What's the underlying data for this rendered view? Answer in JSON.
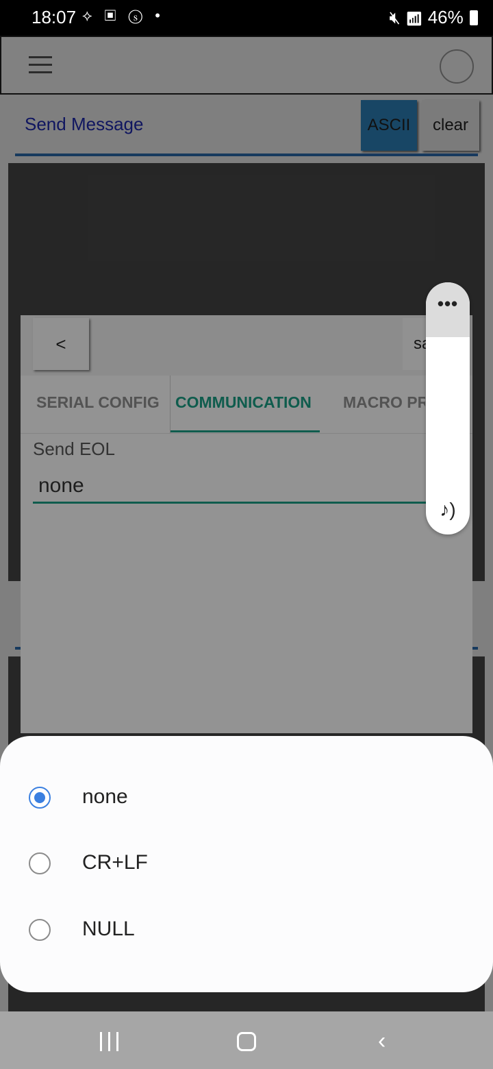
{
  "status_bar": {
    "time": "18:07",
    "left_icons": "⟡ ▣ ⓢ •",
    "right_text": "46%",
    "right_icons": [
      "mute-icon",
      "wifi-icon",
      "signal-icon",
      "battery-icon"
    ]
  },
  "app": {
    "send_message_label": "Send Message",
    "ascii_button": "ASCII",
    "clear_button": "clear"
  },
  "settings_dialog": {
    "back_button": "<",
    "save_button": "sa",
    "tabs": [
      {
        "label": "SERIAL CONFIG",
        "active": false
      },
      {
        "label": "COMMUNICATION",
        "active": true
      },
      {
        "label": "MACRO PR",
        "active": false
      }
    ],
    "send_eol_label": "Send EOL",
    "send_eol_value": "none"
  },
  "volume_panel": {
    "more_label": "•••",
    "icon": "music-note-volume-icon"
  },
  "eol_options": {
    "selected": "none",
    "options": [
      {
        "label": "none",
        "checked": true
      },
      {
        "label": "CR+LF",
        "checked": false
      },
      {
        "label": "NULL",
        "checked": false
      }
    ]
  },
  "nav_bar": {
    "back_glyph": "‹"
  },
  "colors": {
    "accent_teal": "#1a9a80",
    "radio_blue": "#3a7fe0",
    "link_blue": "#1f2bb8"
  }
}
